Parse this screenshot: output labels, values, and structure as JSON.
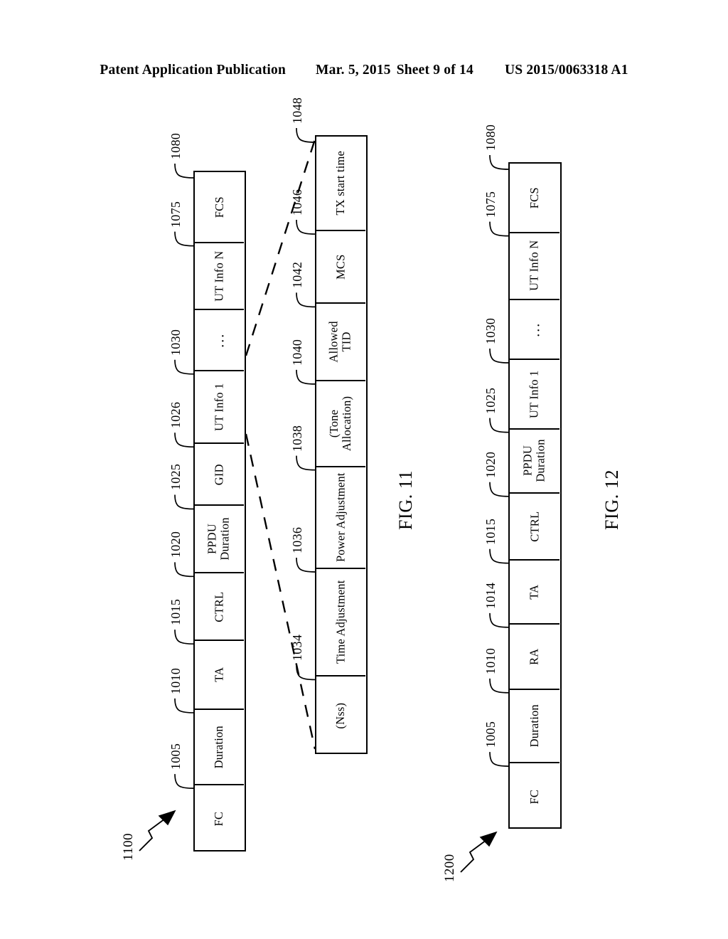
{
  "header": {
    "publication": "Patent Application Publication",
    "date": "Mar. 5, 2015",
    "sheet": "Sheet 9 of 14",
    "patent_number": "US 2015/0063318 A1"
  },
  "figures": [
    {
      "id": "fig11",
      "caption": "FIG. 11",
      "figure_number": "1100",
      "frame_fields": [
        {
          "label": "FC",
          "ref": "1005"
        },
        {
          "label": "Duration",
          "ref": "1010"
        },
        {
          "label": "TA",
          "ref": "1015"
        },
        {
          "label": "CTRL",
          "ref": "1020"
        },
        {
          "label": "PPDU\nDuration",
          "ref": "1025"
        },
        {
          "label": "GID",
          "ref": "1026"
        },
        {
          "label": "UT Info 1",
          "ref": "1030"
        },
        {
          "label": "...",
          "ref": ""
        },
        {
          "label": "UT Info N",
          "ref": "1075"
        },
        {
          "label": "FCS",
          "ref": "1080"
        }
      ],
      "detail_fields": [
        {
          "label": "(Nss)",
          "ref": "1034"
        },
        {
          "label": "Time Adjustment",
          "ref": "1036"
        },
        {
          "label": "Power Adjustment",
          "ref": "1038"
        },
        {
          "label": "(Tone\nAllocation)",
          "ref": "1040"
        },
        {
          "label": "Allowed\nTID",
          "ref": "1042"
        },
        {
          "label": "MCS",
          "ref": "1046"
        },
        {
          "label": "TX start time",
          "ref": "1048"
        }
      ]
    },
    {
      "id": "fig12",
      "caption": "FIG. 12",
      "figure_number": "1200",
      "frame_fields": [
        {
          "label": "FC",
          "ref": "1005"
        },
        {
          "label": "Duration",
          "ref": "1010"
        },
        {
          "label": "RA",
          "ref": "1014"
        },
        {
          "label": "TA",
          "ref": "1015"
        },
        {
          "label": "CTRL",
          "ref": "1020"
        },
        {
          "label": "PPDU\nDuration",
          "ref": "1025"
        },
        {
          "label": "UT Info 1",
          "ref": "1030"
        },
        {
          "label": "...",
          "ref": ""
        },
        {
          "label": "UT Info N",
          "ref": "1075"
        },
        {
          "label": "FCS",
          "ref": "1080"
        }
      ]
    }
  ]
}
